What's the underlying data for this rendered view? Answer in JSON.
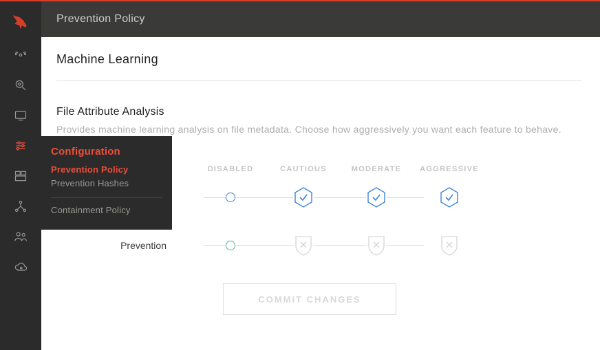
{
  "header": {
    "title": "Prevention Policy"
  },
  "sidebar": {
    "brand_icon": "falcon-logo-icon",
    "items": [
      {
        "name": "radar-icon"
      },
      {
        "name": "search-icon"
      },
      {
        "name": "monitor-icon"
      },
      {
        "name": "sliders-icon",
        "active": true
      },
      {
        "name": "dashboard-icon"
      },
      {
        "name": "network-icon"
      },
      {
        "name": "users-icon"
      },
      {
        "name": "cloud-icon"
      }
    ]
  },
  "flyout": {
    "title": "Configuration",
    "group1": [
      {
        "label": "Prevention Policy",
        "active": true
      },
      {
        "label": "Prevention Hashes",
        "active": false
      }
    ],
    "group2": [
      {
        "label": "Containment Policy",
        "active": false
      }
    ]
  },
  "main": {
    "section_title": "Machine Learning",
    "subsection_title": "File Attribute Analysis",
    "subsection_desc": "Provides machine learning analysis on file metadata. Choose how aggressively you want each feature to behave.",
    "levels": [
      "DISABLED",
      "CAUTIOUS",
      "MODERATE",
      "AGGRESSIVE"
    ],
    "rows": [
      {
        "label": "",
        "type": "detection",
        "selected_index": 0
      },
      {
        "label": "Prevention",
        "type": "prevention",
        "selected_index": 0
      }
    ],
    "commit_label": "COMMIT CHANGES"
  },
  "colors": {
    "accent": "#ec4e3a",
    "blue": "#3b84d8",
    "green": "#4bbf8c"
  }
}
